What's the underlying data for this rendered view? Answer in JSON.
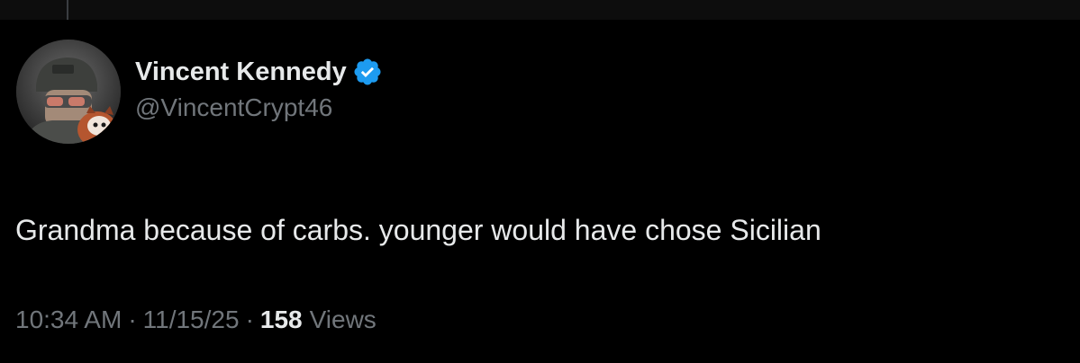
{
  "tweet": {
    "author": {
      "display_name": "Vincent Kennedy",
      "handle": "@VincentCrypt46",
      "verified": true,
      "avatar_icon": "avatar-soldier-with-red-panda"
    },
    "text": "Grandma because of carbs. younger would have chose Sicilian",
    "meta": {
      "time": "10:34 AM",
      "separator": "·",
      "date": "11/15/25",
      "views_count": "158",
      "views_label": "Views"
    }
  },
  "colors": {
    "background": "#000000",
    "primary_text": "#e7e9ea",
    "secondary_text": "#71767b",
    "verified_badge": "#1d9bf0"
  }
}
